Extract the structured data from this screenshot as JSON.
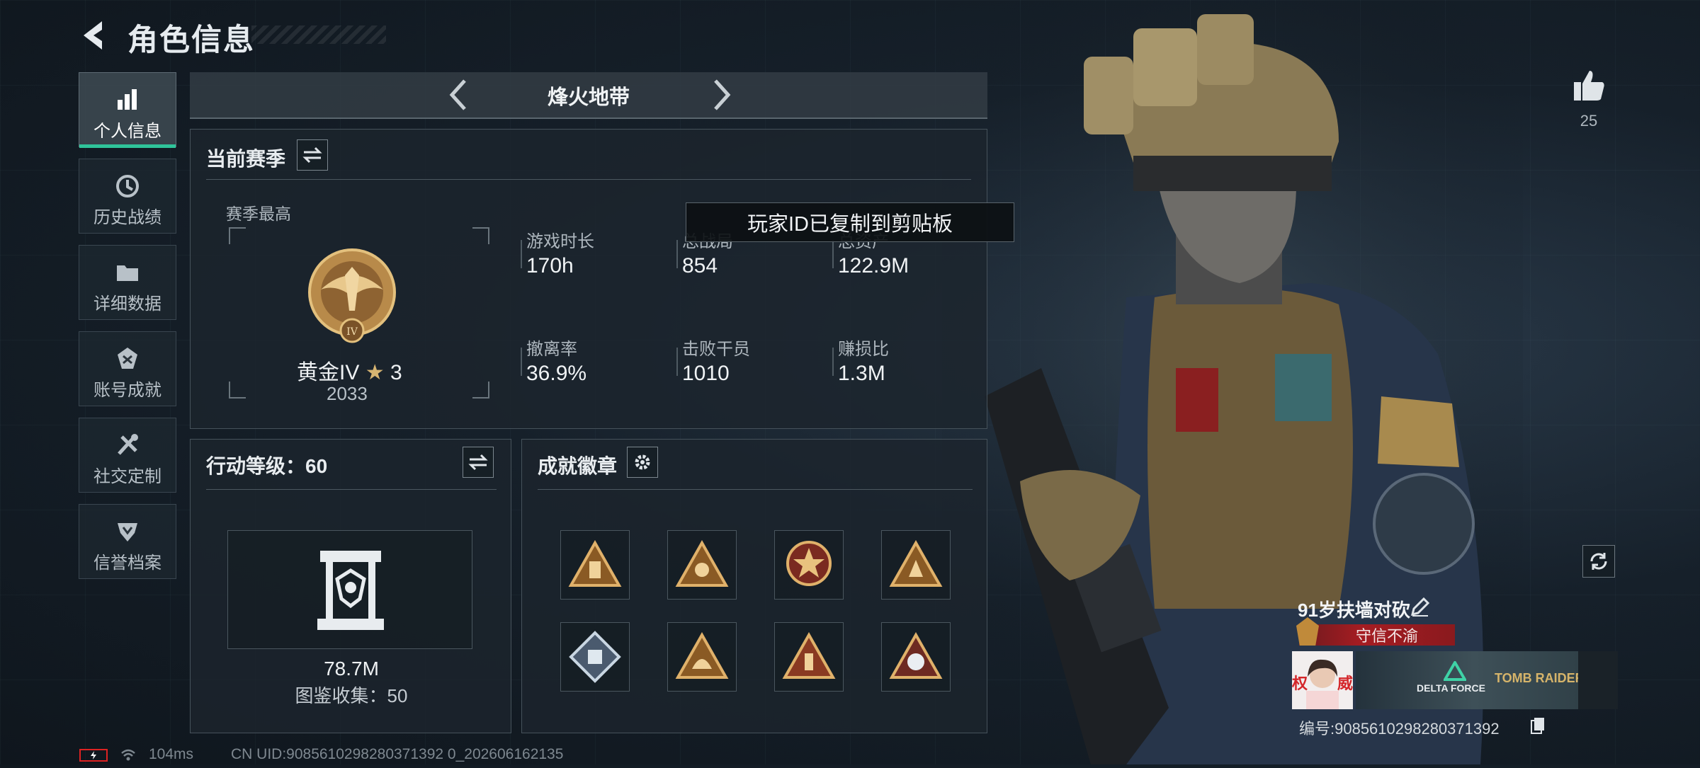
{
  "header": {
    "title": "角色信息"
  },
  "sidebar": {
    "items": [
      {
        "label": "个人信息",
        "icon": "bar-chart-icon",
        "active": true
      },
      {
        "label": "历史战绩",
        "icon": "clock-icon",
        "active": false
      },
      {
        "label": "详细数据",
        "icon": "folder-icon",
        "active": false
      },
      {
        "label": "账号成就",
        "icon": "achievement-icon",
        "active": false
      },
      {
        "label": "社交定制",
        "icon": "tools-icon",
        "active": false
      },
      {
        "label": "信誉档案",
        "icon": "shield-icon",
        "active": false
      }
    ]
  },
  "mode": {
    "name": "烽火地带"
  },
  "season": {
    "title": "当前赛季",
    "best_label": "赛季最高",
    "rank_name": "黄金IV",
    "rank_stars": "3",
    "rank_score": "2033",
    "stats": [
      {
        "label": "游戏时长",
        "value": "170h"
      },
      {
        "label": "总战局",
        "value": "854"
      },
      {
        "label": "总资产",
        "value": "122.9M"
      },
      {
        "label": "撤离率",
        "value": "36.9%"
      },
      {
        "label": "击败干员",
        "value": "1010"
      },
      {
        "label": "赚损比",
        "value": "1.3M"
      }
    ]
  },
  "toast": {
    "text": "玩家ID已复制到剪贴板"
  },
  "action_level": {
    "title": "行动等级：60",
    "value": "78.7M",
    "collection": "图鉴收集：50"
  },
  "badges": {
    "title": "成就徽章"
  },
  "likes": {
    "count": "25"
  },
  "player": {
    "name": "91岁扶墙对砍",
    "title_badge": "守信不渝",
    "id_label": "编号:9085610298280371392",
    "banner_text_1": "DELTA FORCE",
    "banner_text_2": "TOMB RAIDER",
    "avatar_text": "权 威"
  },
  "status_bar": {
    "ping": "104ms",
    "uid": "CN UID:9085610298280371392 0_202606162135"
  },
  "colors": {
    "accent": "#2fc49a",
    "title_red": "#a51c22"
  }
}
